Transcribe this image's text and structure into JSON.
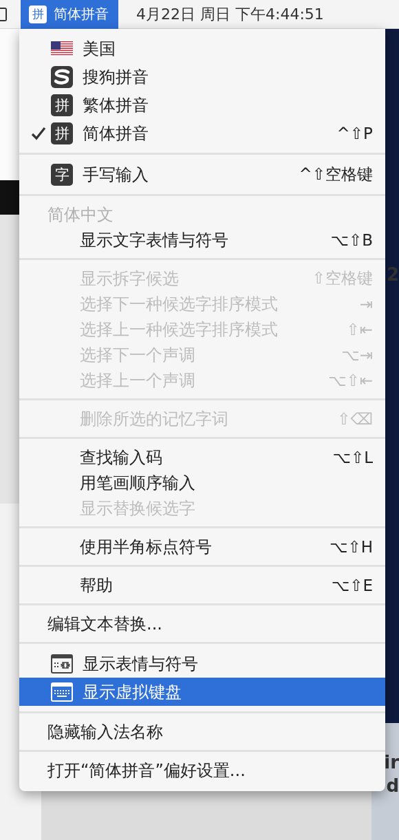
{
  "menu_bar": {
    "input_menu": {
      "badge": "拼",
      "label": "简体拼音",
      "selected": true
    },
    "clock": "4月22日 周日 下午4:44:51"
  },
  "desktop": {
    "fragments": [
      "2",
      "ir",
      "d"
    ]
  },
  "menu": {
    "sections": [
      {
        "items": [
          {
            "kind": "flag",
            "label": "美国",
            "checked": false,
            "disabled": false,
            "selected": false
          },
          {
            "kind": "logo",
            "label": "搜狗拼音",
            "checked": false,
            "disabled": false,
            "selected": false
          },
          {
            "kind": "badge",
            "badge": "拼",
            "label": "繁体拼音",
            "checked": false,
            "disabled": false,
            "selected": false
          },
          {
            "kind": "badge",
            "badge": "拼",
            "label": "简体拼音",
            "shortcut": "^⇧P",
            "checked": true,
            "disabled": false,
            "selected": false
          }
        ]
      },
      {
        "items": [
          {
            "kind": "badge",
            "badge": "字",
            "label": "手写输入",
            "shortcut": "^⇧空格键",
            "disabled": false,
            "selected": false
          }
        ]
      },
      {
        "items": [
          {
            "kind": "header",
            "label": "简体中文"
          },
          {
            "kind": "option",
            "label": "显示文字表情与符号",
            "shortcut": "⌥⇧B",
            "disabled": false,
            "selected": false
          }
        ]
      },
      {
        "items": [
          {
            "kind": "option",
            "label": "显示拆字候选",
            "shortcut": "⇧空格键",
            "disabled": true,
            "selected": false
          },
          {
            "kind": "option",
            "label": "选择下一种候选字排序模式",
            "shortcut": "⇥",
            "disabled": true,
            "selected": false
          },
          {
            "kind": "option",
            "label": "选择上一种候选字排序模式",
            "shortcut": "⇧⇤",
            "disabled": true,
            "selected": false
          },
          {
            "kind": "option",
            "label": "选择下一个声调",
            "shortcut": "⌥⇥",
            "disabled": true,
            "selected": false
          },
          {
            "kind": "option",
            "label": "选择上一个声调",
            "shortcut": "⌥⇧⇤",
            "disabled": true,
            "selected": false
          }
        ]
      },
      {
        "items": [
          {
            "kind": "option",
            "label": "删除所选的记忆字词",
            "shortcut": "⇧⌫",
            "disabled": true,
            "selected": false
          }
        ]
      },
      {
        "items": [
          {
            "kind": "option",
            "label": "查找输入码",
            "shortcut": "⌥⇧L",
            "disabled": false,
            "selected": false
          },
          {
            "kind": "option",
            "label": "用笔画顺序输入",
            "disabled": false,
            "selected": false
          },
          {
            "kind": "option",
            "label": "显示替换候选字",
            "disabled": true,
            "selected": false
          }
        ]
      },
      {
        "items": [
          {
            "kind": "option",
            "label": "使用半角标点符号",
            "shortcut": "⌥⇧H",
            "disabled": false,
            "selected": false
          }
        ]
      },
      {
        "items": [
          {
            "kind": "option",
            "label": "帮助",
            "shortcut": "⌥⇧E",
            "disabled": false,
            "selected": false
          }
        ]
      },
      {
        "items": [
          {
            "kind": "command",
            "label": "编辑文本替换...",
            "disabled": false,
            "selected": false
          }
        ]
      },
      {
        "items": [
          {
            "kind": "viewer",
            "label": "显示表情与符号",
            "disabled": false,
            "selected": false
          },
          {
            "kind": "keyboard",
            "label": "显示虚拟键盘",
            "disabled": false,
            "selected": true
          }
        ]
      },
      {
        "items": [
          {
            "kind": "command",
            "label": "隐藏输入法名称",
            "disabled": false,
            "selected": false
          }
        ]
      },
      {
        "items": [
          {
            "kind": "command",
            "label": "打开“简体拼音”偏好设置...",
            "disabled": false,
            "selected": false
          }
        ]
      }
    ]
  }
}
